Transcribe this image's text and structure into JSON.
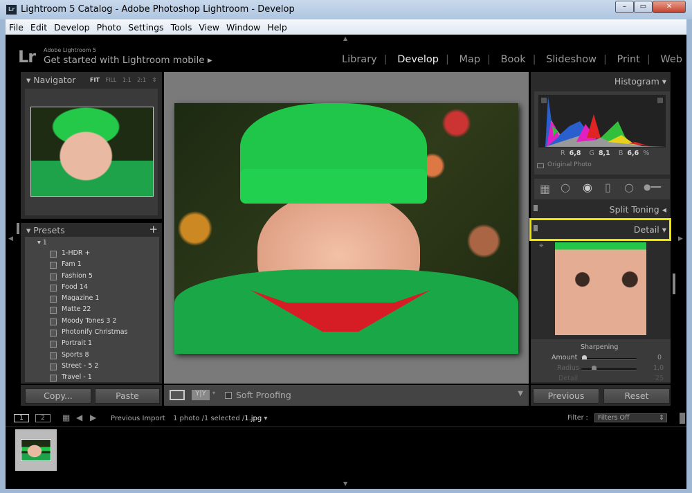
{
  "window": {
    "title": "Lightroom 5 Catalog - Adobe Photoshop Lightroom - Develop",
    "app_icon": "Lr"
  },
  "menu": [
    "File",
    "Edit",
    "Develop",
    "Photo",
    "Settings",
    "Tools",
    "View",
    "Window",
    "Help"
  ],
  "identity": {
    "logo": "Lr",
    "product": "Adobe Lightroom 5",
    "tagline": "Get started with Lightroom mobile ▸"
  },
  "modules": [
    "Library",
    "Develop",
    "Map",
    "Book",
    "Slideshow",
    "Print",
    "Web"
  ],
  "active_module": "Develop",
  "navigator": {
    "title": "Navigator",
    "zoom": [
      "FIT",
      "FILL",
      "1:1",
      "2:1"
    ],
    "active_zoom": "FIT"
  },
  "presets": {
    "title": "Presets",
    "add": "+",
    "folder": "1",
    "items": [
      "1-HDR +",
      "Fam 1",
      "Fashion 5",
      "Food 14",
      "Magazine 1",
      "Matte 22",
      "Moody Tones 3 2",
      "Photonify Christmas",
      "Portrait 1",
      "Sports 8",
      "Street - 5 2",
      "Travel - 1"
    ]
  },
  "left_buttons": {
    "copy": "Copy...",
    "paste": "Paste"
  },
  "toolbar": {
    "soft_proofing": "Soft Proofing",
    "soft_proofing_checked": false,
    "compare": "Y|Y"
  },
  "histogram": {
    "title": "Histogram",
    "r_label": "R",
    "r": "6,8",
    "g_label": "G",
    "g": "8,1",
    "b_label": "B",
    "b": "6,6",
    "unit": "%",
    "original_photo": "Original Photo"
  },
  "panels": {
    "split_toning": "Split Toning",
    "detail": "Detail",
    "highlight_color": "#f0e600"
  },
  "sharpening": {
    "title": "Sharpening",
    "amount_label": "Amount",
    "amount": "0",
    "radius_label": "Radius",
    "radius": "1,0",
    "detail_label": "Detail",
    "detail": "25"
  },
  "right_buttons": {
    "previous": "Previous",
    "reset": "Reset"
  },
  "filmstrip": {
    "view1": "1",
    "view2": "2",
    "source": "Previous Import",
    "info": "1 photo /1 selected /",
    "file": "1.jpg",
    "filter_label": "Filter :",
    "filter_value": "Filters Off"
  }
}
